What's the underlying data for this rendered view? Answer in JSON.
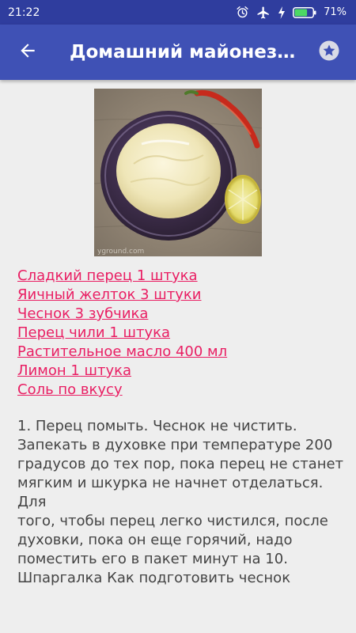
{
  "status_bar": {
    "time": "21:22",
    "battery_percent": "71%",
    "battery_level": 0.71,
    "icons": [
      "alarm-icon",
      "airplane-mode-icon",
      "charging-icon",
      "battery-icon"
    ]
  },
  "app_bar": {
    "title": "Домашний майонез с …",
    "back_icon": "arrow-back-icon",
    "favorite_icon": "star-icon"
  },
  "recipe": {
    "photo_watermark": "yground.com",
    "ingredients": [
      "Сладкий перец 1 штука",
      "Яичный желток 3 штуки",
      "Чеснок 3 зубчика",
      "Перец чили 1 штука",
      "Растительное масло 400 мл",
      "Лимон 1 штука",
      "Соль по вкусу"
    ],
    "step_lines": [
      "1. Перец помыть. Чеснок не чистить.",
      "Запекать в духовке при температуре 200",
      "градусов до тех пор, пока перец не станет",
      "мягким и шкурка не начнет отделаться. Для",
      "того, чтобы перец легко чистился, после",
      "духовки, пока он еще горячий, надо",
      "поместить его в пакет минут на 10.",
      "Шпаргалка Как подготовить чеснок"
    ]
  },
  "colors": {
    "status_bar": "#2f3d9e",
    "app_bar": "#3f51b5",
    "background": "#eeeeee",
    "link": "#e91e63",
    "body_text": "#444444"
  }
}
